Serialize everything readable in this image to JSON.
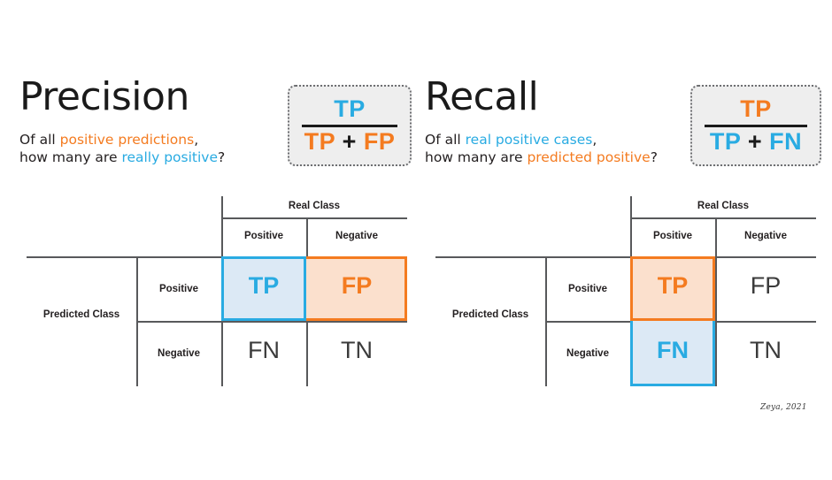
{
  "precision": {
    "title": "Precision",
    "question": {
      "line1_prefix": "Of all ",
      "line1_highlight": "positive predictions",
      "line1_suffix": ",",
      "line2_prefix": "how many are ",
      "line2_highlight": "really positive",
      "line2_suffix": "?"
    },
    "formula": {
      "numerator": "TP",
      "denominator_left": "TP",
      "operator": "+",
      "denominator_right": "FP"
    },
    "matrix": {
      "column_group_label": "Real Class",
      "row_group_label": "Predicted Class",
      "column_headers": [
        "Positive",
        "Negative"
      ],
      "row_headers": [
        "Positive",
        "Negative"
      ],
      "cells": [
        [
          "TP",
          "FP"
        ],
        [
          "FN",
          "TN"
        ]
      ],
      "highlight_outer": "TP + FP row",
      "highlight_inner": "TP cell"
    }
  },
  "recall": {
    "title": "Recall",
    "question": {
      "line1_prefix": "Of all ",
      "line1_highlight": "real positive cases",
      "line1_suffix": ",",
      "line2_prefix": "how many are ",
      "line2_highlight": "predicted positive",
      "line2_suffix": "?"
    },
    "formula": {
      "numerator": "TP",
      "denominator_left": "TP",
      "operator": "+",
      "denominator_right": "FN"
    },
    "matrix": {
      "column_group_label": "Real Class",
      "row_group_label": "Predicted Class",
      "column_headers": [
        "Positive",
        "Negative"
      ],
      "row_headers": [
        "Positive",
        "Negative"
      ],
      "cells": [
        [
          "TP",
          "FP"
        ],
        [
          "FN",
          "TN"
        ]
      ],
      "highlight_outer": "TP + FN column",
      "highlight_inner": "TP cell"
    }
  },
  "credit": "Zeya, 2021",
  "colors": {
    "blue": "#29abe2",
    "orange": "#f47b20",
    "blue_fill": "#dce9f5",
    "orange_fill": "#fbe0cd",
    "grid_line": "#58595b",
    "card_bg": "#eeeeee",
    "text": "#231f20"
  }
}
